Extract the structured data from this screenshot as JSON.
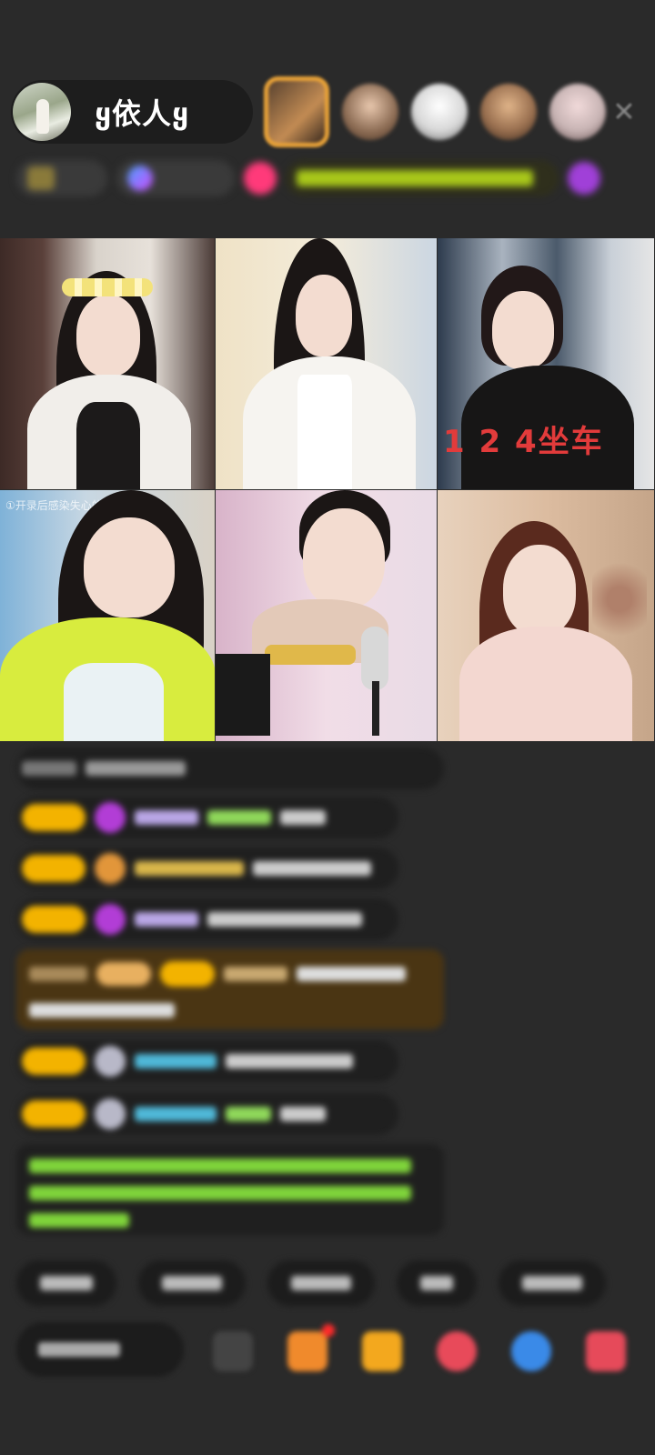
{
  "header": {
    "host_name": "ყ依人ყ",
    "close_glyph": "✕",
    "viewers": [
      {
        "color": "#a07c5a",
        "style": "gold"
      },
      {
        "color": "#8a6a52",
        "style": "round"
      },
      {
        "color": "#d8d8d8",
        "style": "round"
      },
      {
        "color": "#9a7050",
        "style": "round"
      },
      {
        "color": "#c8b4b4",
        "style": "round"
      }
    ],
    "info_chips": [
      "",
      "",
      "",
      "",
      ""
    ]
  },
  "video_grid": {
    "cells": [
      {
        "caption": "",
        "overlay": ""
      },
      {
        "caption": "",
        "overlay": ""
      },
      {
        "caption": "",
        "overlay": "1 2 4坐车"
      },
      {
        "caption": "①开录后感染失心的情患",
        "overlay": ""
      },
      {
        "caption": "",
        "overlay": ""
      },
      {
        "caption": "",
        "overlay": ""
      }
    ]
  },
  "chat": {
    "colors": {
      "badge": "#f3b300",
      "gem_purple": "#b23dd6",
      "gem_orange": "#e2963a",
      "name_lavender": "#b9a6e6",
      "name_green": "#8fd85a",
      "name_gold": "#d9b64a",
      "name_cyan": "#4fb8d8",
      "system_green": "#7fd43a",
      "highlight_bg": "#4a3513"
    }
  },
  "quick_replies": [
    "",
    "",
    "",
    "",
    ""
  ],
  "bottom_bar": {
    "say_placeholder": "",
    "tool_colors": [
      "#444444",
      "#f08a2c",
      "#f3a81e",
      "#e84a5a",
      "#3a8ae8",
      "#e64a5a"
    ]
  }
}
